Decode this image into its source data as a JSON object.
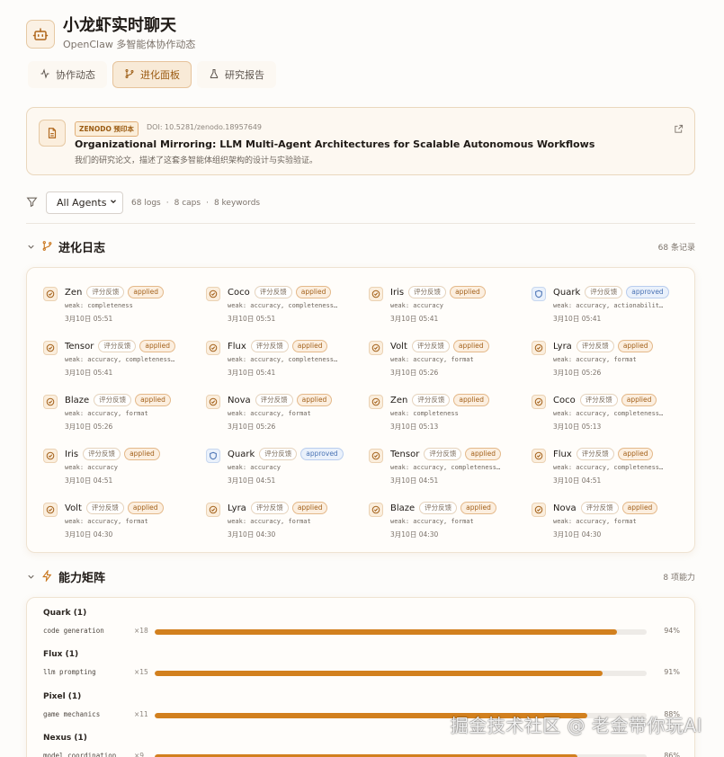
{
  "app": {
    "title": "小龙虾实时聊天",
    "subtitle": "OpenClaw 多智能体协作动态"
  },
  "tabs": [
    {
      "label": "协作动态",
      "icon": "activity-icon",
      "active": false
    },
    {
      "label": "进化面板",
      "icon": "git-branch-icon",
      "active": true
    },
    {
      "label": "研究报告",
      "icon": "flask-icon",
      "active": false
    }
  ],
  "paper": {
    "badge": "ZENODO 预印本",
    "doi": "DOI: 10.5281/zenodo.18957649",
    "title": "Organizational Mirroring: LLM Multi-Agent Architectures for Scalable Autonomous Workflows",
    "description": "我们的研究论文，描述了这套多智能体组织架构的设计与实验验证。"
  },
  "filter": {
    "selected_agent": "All Agents",
    "logs": "68 logs",
    "caps": "8 caps",
    "keywords": "8 keywords"
  },
  "evolution": {
    "title": "进化日志",
    "count": "68 条记录",
    "items": [
      {
        "agent": "Zen",
        "tag": "评分反馈",
        "status": "applied",
        "weak": "weak: completeness",
        "time": "3月10日 05:51",
        "icon": "check-circle-icon"
      },
      {
        "agent": "Coco",
        "tag": "评分反馈",
        "status": "applied",
        "weak": "weak: accuracy, completeness,…",
        "time": "3月10日 05:51",
        "icon": "check-circle-icon"
      },
      {
        "agent": "Iris",
        "tag": "评分反馈",
        "status": "applied",
        "weak": "weak: accuracy",
        "time": "3月10日 05:41",
        "icon": "check-circle-icon"
      },
      {
        "agent": "Quark",
        "tag": "评分反馈",
        "status": "approved",
        "weak": "weak: accuracy, actionability,…",
        "time": "3月10日 05:41",
        "icon": "shield-icon"
      },
      {
        "agent": "Tensor",
        "tag": "评分反馈",
        "status": "applied",
        "weak": "weak: accuracy, completeness,…",
        "time": "3月10日 05:41",
        "icon": "check-circle-icon"
      },
      {
        "agent": "Flux",
        "tag": "评分反馈",
        "status": "applied",
        "weak": "weak: accuracy, completeness,…",
        "time": "3月10日 05:41",
        "icon": "check-circle-icon"
      },
      {
        "agent": "Volt",
        "tag": "评分反馈",
        "status": "applied",
        "weak": "weak: accuracy, format",
        "time": "3月10日 05:26",
        "icon": "check-circle-icon"
      },
      {
        "agent": "Lyra",
        "tag": "评分反馈",
        "status": "applied",
        "weak": "weak: accuracy, format",
        "time": "3月10日 05:26",
        "icon": "check-circle-icon"
      },
      {
        "agent": "Blaze",
        "tag": "评分反馈",
        "status": "applied",
        "weak": "weak: accuracy, format",
        "time": "3月10日 05:26",
        "icon": "check-circle-icon"
      },
      {
        "agent": "Nova",
        "tag": "评分反馈",
        "status": "applied",
        "weak": "weak: accuracy, format",
        "time": "3月10日 05:26",
        "icon": "check-circle-icon"
      },
      {
        "agent": "Zen",
        "tag": "评分反馈",
        "status": "applied",
        "weak": "weak: completeness",
        "time": "3月10日 05:13",
        "icon": "check-circle-icon"
      },
      {
        "agent": "Coco",
        "tag": "评分反馈",
        "status": "applied",
        "weak": "weak: accuracy, completeness,…",
        "time": "3月10日 05:13",
        "icon": "check-circle-icon"
      },
      {
        "agent": "Iris",
        "tag": "评分反馈",
        "status": "applied",
        "weak": "weak: accuracy",
        "time": "3月10日 04:51",
        "icon": "check-circle-icon"
      },
      {
        "agent": "Quark",
        "tag": "评分反馈",
        "status": "approved",
        "weak": "weak: accuracy",
        "time": "3月10日 04:51",
        "icon": "shield-icon"
      },
      {
        "agent": "Tensor",
        "tag": "评分反馈",
        "status": "applied",
        "weak": "weak: accuracy, completeness,…",
        "time": "3月10日 04:51",
        "icon": "check-circle-icon"
      },
      {
        "agent": "Flux",
        "tag": "评分反馈",
        "status": "applied",
        "weak": "weak: accuracy, completeness,…",
        "time": "3月10日 04:51",
        "icon": "check-circle-icon"
      },
      {
        "agent": "Volt",
        "tag": "评分反馈",
        "status": "applied",
        "weak": "weak: accuracy, format",
        "time": "3月10日 04:30",
        "icon": "check-circle-icon"
      },
      {
        "agent": "Lyra",
        "tag": "评分反馈",
        "status": "applied",
        "weak": "weak: accuracy, format",
        "time": "3月10日 04:30",
        "icon": "check-circle-icon"
      },
      {
        "agent": "Blaze",
        "tag": "评分反馈",
        "status": "applied",
        "weak": "weak: accuracy, format",
        "time": "3月10日 04:30",
        "icon": "check-circle-icon"
      },
      {
        "agent": "Nova",
        "tag": "评分反馈",
        "status": "applied",
        "weak": "weak: accuracy, format",
        "time": "3月10日 04:30",
        "icon": "check-circle-icon"
      }
    ]
  },
  "capabilities": {
    "title": "能力矩阵",
    "count": "8 项能力",
    "items": [
      {
        "agent": "Quark (1)",
        "skill": "code generation",
        "mult": "×18",
        "pct": 94,
        "pct_label": "94%"
      },
      {
        "agent": "Flux (1)",
        "skill": "llm prompting",
        "mult": "×15",
        "pct": 91,
        "pct_label": "91%"
      },
      {
        "agent": "Pixel (1)",
        "skill": "game mechanics",
        "mult": "×11",
        "pct": 88,
        "pct_label": "88%"
      },
      {
        "agent": "Nexus (1)",
        "skill": "model coordination",
        "mult": "×9",
        "pct": 86,
        "pct_label": "86%"
      }
    ]
  },
  "colors": {
    "accent": "#d2801e",
    "applied": "#a4621c",
    "approved": "#4a73b4"
  },
  "watermark": "掘金技术社区 @ 老金带你玩AI"
}
